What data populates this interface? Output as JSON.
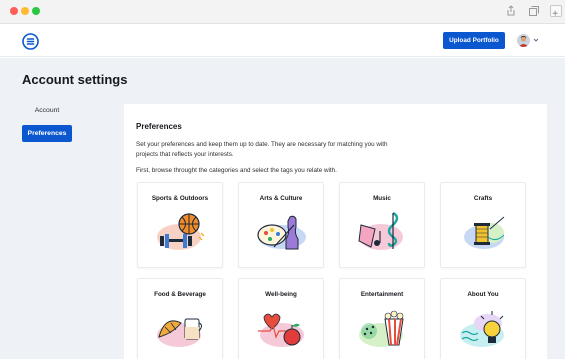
{
  "app": {
    "upload_button": "Upload Portfolio"
  },
  "page": {
    "title": "Account settings"
  },
  "sidebar": {
    "items": [
      {
        "label": "Account",
        "active": false
      },
      {
        "label": "Preferences",
        "active": true
      }
    ]
  },
  "preferences": {
    "title": "Preferences",
    "description": "Set your preferences and keep them up to date. They are necessary for matching you with projects that reflects your interests.",
    "hint": "First, browse throught the categories and select the tags you relate with.",
    "categories": [
      {
        "label": "Sports & Outdoors",
        "icon": "sports-icon"
      },
      {
        "label": "Arts & Culture",
        "icon": "arts-icon"
      },
      {
        "label": "Music",
        "icon": "music-icon"
      },
      {
        "label": "Crafts",
        "icon": "crafts-icon"
      },
      {
        "label": "Food & Beverage",
        "icon": "food-icon"
      },
      {
        "label": "Well-being",
        "icon": "wellbeing-icon"
      },
      {
        "label": "Entertainment",
        "icon": "entertainment-icon"
      },
      {
        "label": "About You",
        "icon": "about-you-icon"
      }
    ]
  },
  "colors": {
    "primary": "#0b57d0",
    "page_background": "#eef1f6"
  }
}
